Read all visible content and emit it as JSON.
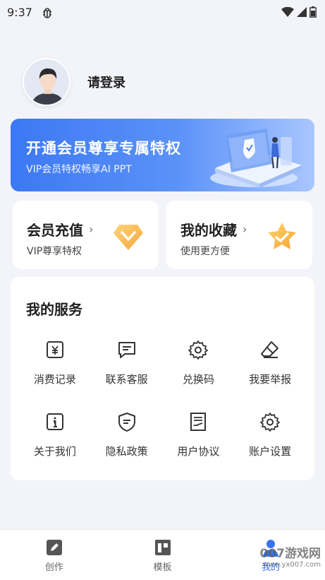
{
  "status_bar": {
    "time": "9:37"
  },
  "profile": {
    "login_label": "请登录"
  },
  "vip_banner": {
    "title": "开通会员尊享专属特权",
    "subtitle": "VIP会员特权畅享AI PPT"
  },
  "cards": [
    {
      "title": "会员充值",
      "subtitle": "VIP尊享特权"
    },
    {
      "title": "我的收藏",
      "subtitle": "使用更方便"
    }
  ],
  "services": {
    "title": "我的服务",
    "items": [
      {
        "label": "消费记录",
        "icon": "yuan-receipt-icon"
      },
      {
        "label": "联系客服",
        "icon": "chat-icon"
      },
      {
        "label": "兑换码",
        "icon": "gear-icon"
      },
      {
        "label": "我要举报",
        "icon": "eraser-icon"
      },
      {
        "label": "关于我们",
        "icon": "info-icon"
      },
      {
        "label": "隐私政策",
        "icon": "shield-icon"
      },
      {
        "label": "用户协议",
        "icon": "document-icon"
      },
      {
        "label": "账户设置",
        "icon": "settings-icon"
      }
    ]
  },
  "tabbar": {
    "items": [
      {
        "label": "创作",
        "icon": "edit-icon",
        "active": false
      },
      {
        "label": "模板",
        "icon": "template-icon",
        "active": false
      },
      {
        "label": "我的",
        "icon": "user-icon",
        "active": true
      }
    ]
  },
  "watermark": {
    "text": "007游戏网",
    "url": "www.yx007.com"
  },
  "colors": {
    "accent": "#3a72f2",
    "banner_start": "#3c78f4",
    "banner_end": "#a9c6ff",
    "background": "#f3f4f9"
  }
}
